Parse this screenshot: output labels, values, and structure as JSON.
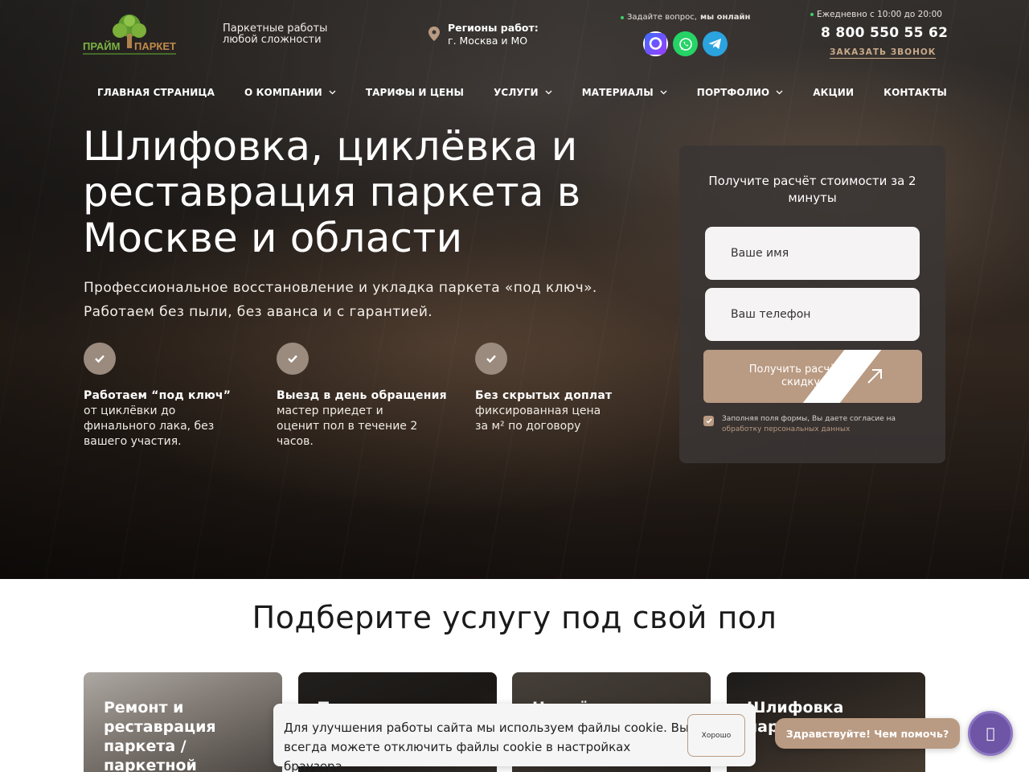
{
  "header": {
    "logo_text_line1": "ПРАЙМ",
    "logo_text_line2": "ПАРКЕТ",
    "tagline": "Паркетные работы любой сложности",
    "region_title": "Регионы работ:",
    "region_value": "г. Москва и МО",
    "online_prefix": "Задайте вопрос,",
    "online_status": "мы онлайн",
    "messengers": [
      "max-icon",
      "whatsapp-icon",
      "telegram-icon"
    ],
    "hours": "Ежедневно с 10:00 до 20:00",
    "phone": "8 800 550 55 62",
    "callback_label": "ЗАКАЗАТЬ ЗВОНОК"
  },
  "nav": {
    "items": [
      {
        "label": "ГЛАВНАЯ СТРАНИЦА",
        "has_dropdown": false
      },
      {
        "label": "О КОМПАНИИ",
        "has_dropdown": true
      },
      {
        "label": "ТАРИФЫ И ЦЕНЫ",
        "has_dropdown": false
      },
      {
        "label": "УСЛУГИ",
        "has_dropdown": true
      },
      {
        "label": "МАТЕРИАЛЫ",
        "has_dropdown": true
      },
      {
        "label": "ПОРТФОЛИО",
        "has_dropdown": true
      },
      {
        "label": "АКЦИИ",
        "has_dropdown": false
      },
      {
        "label": "КОНТАКТЫ",
        "has_dropdown": false
      }
    ]
  },
  "hero": {
    "title": "Шлифовка, циклёвка и реставрация паркета в Москве и области",
    "lead_line1": "Профессиональное восстановление и укладка паркета «под ключ».",
    "lead_line2": "Работаем без пыли, без аванса и с гарантией.",
    "features": [
      {
        "title": "Работаем “под ключ”",
        "desc": "от циклёвки до финального лака, без вашего участия."
      },
      {
        "title": "Выезд в день обращения",
        "desc": "мастер приедет и оценит пол в течение 2 часов."
      },
      {
        "title": "Без скрытых доплат",
        "desc": "фиксированная цена за м² по договору"
      }
    ]
  },
  "form": {
    "title": "Получите расчёт стоимости за 2 минуты",
    "name_placeholder": "Ваше имя",
    "phone_placeholder": "Ваш телефон",
    "submit_label": "Получить расчёт и скидку",
    "consent_text": "Заполняя поля формы, Вы даете согласие на",
    "consent_link": "обработку персональных данных"
  },
  "services": {
    "title": "Подберите услугу под свой пол",
    "cards": [
      {
        "title": "Ремонт и реставрация паркета / паркетной"
      },
      {
        "title": "Тонировка"
      },
      {
        "title": "Циклёвка и"
      },
      {
        "title": "Шлифовка паркетной доски"
      }
    ]
  },
  "cookie": {
    "text": "Для улучшения работы сайта мы используем файлы cookie. Вы всегда можете отключить файлы cookie в настройках браузера.",
    "ok_label": "Хорошо"
  },
  "chat": {
    "greeting": "Здравствуйте! Чем помочь?",
    "button_glyph": ""
  },
  "colors": {
    "accent": "#b99a82",
    "online_dot": "#3ccf6a",
    "chat_button": "#6e55a6"
  }
}
